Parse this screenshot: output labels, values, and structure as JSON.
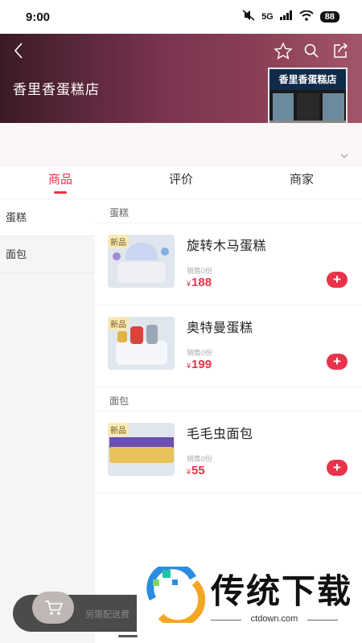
{
  "status_bar": {
    "time": "9:00",
    "network": "5G",
    "battery": "88"
  },
  "header": {
    "store_name": "香里香蛋糕店",
    "store_sign": "香里香蛋糕店",
    "icons": [
      "back-icon",
      "star-icon",
      "search-icon",
      "share-icon"
    ]
  },
  "tabs": [
    {
      "label": "商品",
      "active": true
    },
    {
      "label": "评价",
      "active": false
    },
    {
      "label": "商家",
      "active": false
    }
  ],
  "sidebar": {
    "categories": [
      {
        "label": "蛋糕",
        "active": true
      },
      {
        "label": "面包",
        "active": false
      }
    ]
  },
  "sections": [
    {
      "title": "蛋糕",
      "items": [
        {
          "badge": "新品",
          "name": "旋转木马蛋糕",
          "sales": "销售0份",
          "currency": "¥",
          "price": "188"
        },
        {
          "badge": "新品",
          "name": "奥特曼蛋糕",
          "sales": "销售0份",
          "currency": "¥",
          "price": "199"
        }
      ]
    },
    {
      "title": "面包",
      "items": [
        {
          "badge": "新品",
          "name": "毛毛虫面包",
          "sales": "销售0份",
          "currency": "¥",
          "price": "55"
        }
      ]
    }
  ],
  "add_button_label": "+",
  "cart": {
    "note": "另需配送费"
  },
  "watermark": {
    "title": "传统下载",
    "site": "ctdown.com"
  },
  "colors": {
    "accent": "#e8334a",
    "header_gradient_start": "#3a1a26",
    "header_gradient_end": "#a3566a"
  }
}
